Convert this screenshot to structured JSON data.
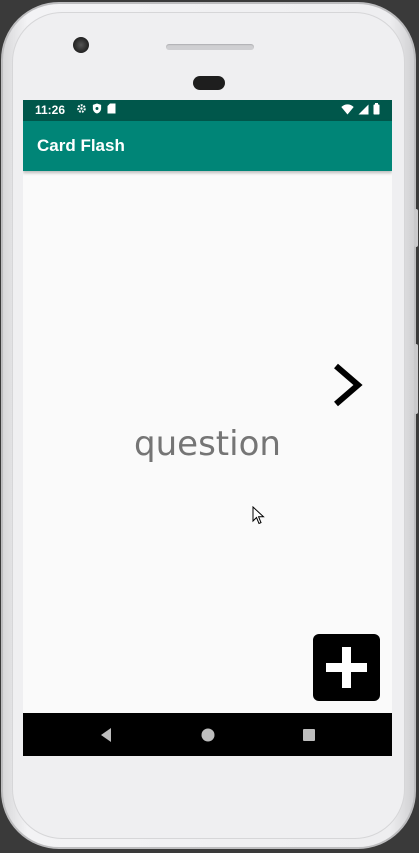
{
  "status_bar": {
    "time": "11:26",
    "left_icons": [
      "gear-icon",
      "shield-icon",
      "sd-card-icon"
    ],
    "right_icons": [
      "wifi-icon",
      "signal-icon",
      "battery-icon"
    ],
    "color": "#00574b"
  },
  "app_bar": {
    "title": "Card Flash",
    "color": "#008577"
  },
  "card": {
    "text": "question"
  },
  "controls": {
    "next_icon": "chevron-right-icon",
    "add_icon": "plus-icon"
  },
  "nav_bar": {
    "icons": [
      "back-icon",
      "home-icon",
      "recents-icon"
    ]
  }
}
